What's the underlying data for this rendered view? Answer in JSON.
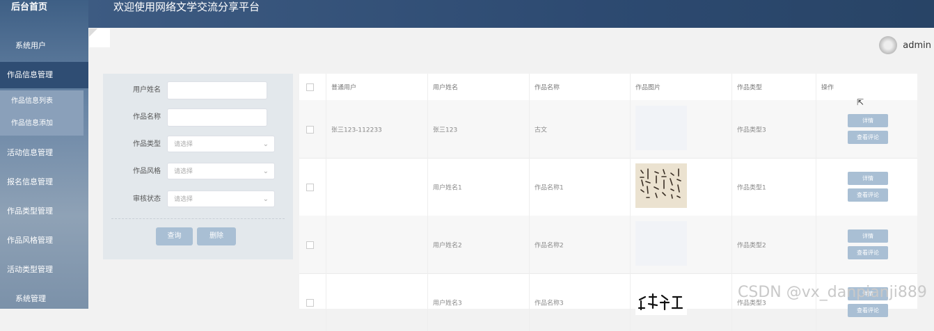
{
  "sidebar": {
    "home": "后台首页",
    "items": [
      {
        "label": "系统用户"
      },
      {
        "label": "作品信息管理"
      },
      {
        "label": "活动信息管理"
      },
      {
        "label": "报名信息管理"
      },
      {
        "label": "作品类型管理"
      },
      {
        "label": "作品风格管理"
      },
      {
        "label": "活动类型管理"
      },
      {
        "label": "系统管理"
      }
    ],
    "subitems": [
      {
        "label": "作品信息列表"
      },
      {
        "label": "作品信息添加"
      }
    ]
  },
  "header": {
    "title": "欢迎使用网络文学交流分享平台",
    "username": "admin"
  },
  "search": {
    "fields": [
      {
        "label": "用户姓名",
        "value": ""
      },
      {
        "label": "作品名称",
        "value": ""
      }
    ],
    "selects": [
      {
        "label": "作品类型",
        "placeholder": "请选择"
      },
      {
        "label": "作品风格",
        "placeholder": "请选择"
      },
      {
        "label": "审核状态",
        "placeholder": "请选择"
      }
    ],
    "query_label": "查询",
    "delete_label": "删除"
  },
  "table": {
    "headers": [
      "普通用户",
      "用户姓名",
      "作品名称",
      "作品图片",
      "作品类型",
      "操作"
    ],
    "rows": [
      {
        "user": "张三123-112233",
        "name": "张三123",
        "title": "古文",
        "type": "作品类型3",
        "image": "blank"
      },
      {
        "user": "",
        "name": "用户姓名1",
        "title": "作品名称1",
        "type": "作品类型1",
        "image": "calligraphy"
      },
      {
        "user": "",
        "name": "用户姓名2",
        "title": "作品名称2",
        "type": "作品类型2",
        "image": "blank"
      },
      {
        "user": "",
        "name": "用户姓名3",
        "title": "作品名称3",
        "type": "作品类型3",
        "image": "calligraphy"
      }
    ],
    "detail_label": "详情",
    "comments_label": "查看评论"
  },
  "watermark": "CSDN @vx_danpianji889"
}
